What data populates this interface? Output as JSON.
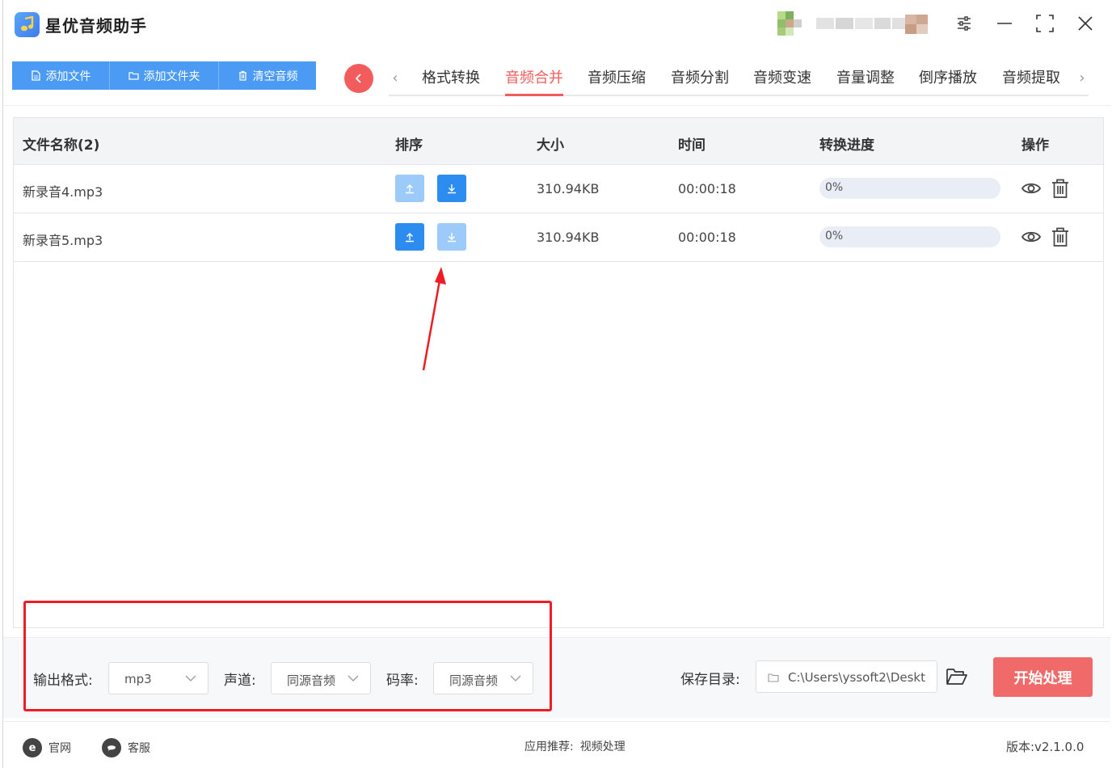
{
  "app": {
    "title": "星优音频助手"
  },
  "toolbar": {
    "add_file": "添加文件",
    "add_folder": "添加文件夹",
    "clear_audio": "清空音频"
  },
  "tabs": [
    {
      "label": "格式转换"
    },
    {
      "label": "音频合并"
    },
    {
      "label": "音频压缩"
    },
    {
      "label": "音频分割"
    },
    {
      "label": "音频变速"
    },
    {
      "label": "音量调整"
    },
    {
      "label": "倒序播放"
    },
    {
      "label": "音频提取"
    }
  ],
  "active_tab": "音频合并",
  "table": {
    "headers": {
      "name": "文件名称(2)",
      "sort": "排序",
      "size": "大小",
      "time": "时间",
      "progress": "转换进度",
      "action": "操作"
    },
    "rows": [
      {
        "name": "新录音4.mp3",
        "size": "310.94KB",
        "time": "00:00:18",
        "progress_text": "0%",
        "progress": 0
      },
      {
        "name": "新录音5.mp3",
        "size": "310.94KB",
        "time": "00:00:18",
        "progress_text": "0%",
        "progress": 0
      }
    ]
  },
  "settings": {
    "format_label": "输出格式:",
    "format_value": "mp3",
    "channel_label": "声道:",
    "channel_value": "同源音频",
    "bitrate_label": "码率:",
    "bitrate_value": "同源音频",
    "save_label": "保存目录:",
    "save_path": "C:\\Users\\yssoft2\\Deskt",
    "start_button": "开始处理"
  },
  "footer": {
    "website": "官网",
    "support": "客服",
    "recommend_label": "应用推荐:",
    "recommend_value": "视频处理",
    "version": "版本:v2.1.0.0"
  },
  "colors": {
    "accent": "#4b9bf5",
    "brand_red": "#f35c5c",
    "annotation_red": "#ee1c24"
  }
}
